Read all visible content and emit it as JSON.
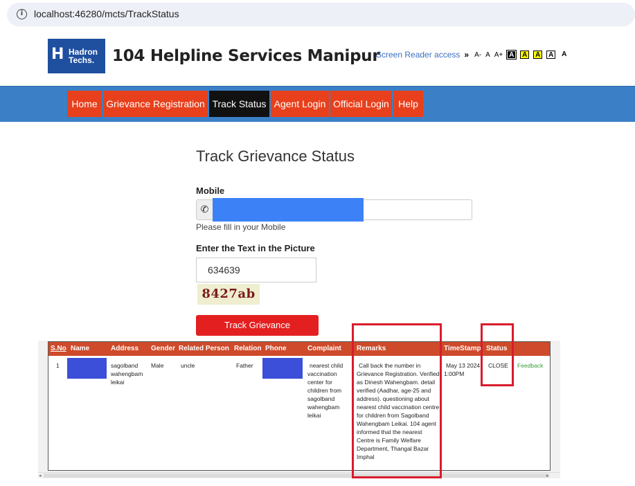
{
  "browser": {
    "url": "localhost:46280/mcts/TrackStatus"
  },
  "header": {
    "logo_mark": "H",
    "logo_text": "Hadron Techs.",
    "title": "104 Helpline Services Manipur",
    "screen_reader_label": "Screen Reader access",
    "screen_reader_arrow": "»",
    "font_sizes": [
      "A-",
      "A",
      "A+"
    ],
    "contrast_options": [
      {
        "label": "A",
        "bg": "#000000",
        "fg": "#ffffff"
      },
      {
        "label": "A",
        "bg": "#ffff00",
        "fg": "#000000"
      },
      {
        "label": "A",
        "bg": "#ffff00",
        "fg": "#000000"
      },
      {
        "label": "A",
        "bg": "#ffffff",
        "fg": "#000000"
      },
      {
        "label": "A",
        "bg": "#ffffff",
        "fg": "#000000"
      }
    ]
  },
  "nav": {
    "items": [
      {
        "label": "Home"
      },
      {
        "label": "Grievance Registration"
      },
      {
        "label": "Track Status",
        "active": true
      },
      {
        "label": "Agent Login"
      },
      {
        "label": "Official Login"
      },
      {
        "label": "Help"
      }
    ]
  },
  "form": {
    "title": "Track Grievance Status",
    "mobile_label": "Mobile",
    "mobile_icon": "phone-icon",
    "mobile_hint": "Please fill in your Mobile",
    "captcha_label": "Enter the Text in the Picture",
    "captcha_input_value": "634639",
    "captcha_image_text": "8427ab",
    "submit_label": "Track Grievance"
  },
  "table": {
    "headers": [
      "S.No",
      "Name",
      "Address",
      "Gender",
      "Related Person",
      "Relation",
      "Phone",
      "Complaint",
      "Remarks",
      "TimeStamp",
      "Status"
    ],
    "rows": [
      {
        "sno": "1",
        "address": "sagolband wahengbam leikai",
        "gender": "Male",
        "related_person": "uncle",
        "relation": "Father",
        "complaint": "nearest child vaccination center for children from sagolband wahengbam leikai",
        "remarks": "Call back the number in Grievance Registration. Verified as Dinesh Wahengbam. detail verified (Aadhar, age-25 and address). questioning about nearest child vaccination centre for children from Sagolband Wahengbam Leikai. 104 agent informed that the nearest Centre is Family Welfare Department, Thangal Bazar Imphal",
        "timestamp": "May 13 2024 1:00PM",
        "status": "CLOSE",
        "feedback_label": "Feedback"
      }
    ]
  },
  "colors": {
    "nav_bg": "#3b80c6",
    "nav_item": "#e8401c",
    "nav_active": "#111111",
    "table_header": "#cf4a2a",
    "button": "#e41f1f",
    "annotation": "#d81b2b"
  }
}
